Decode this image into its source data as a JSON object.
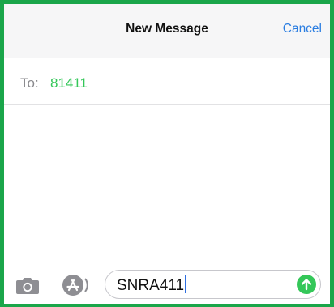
{
  "header": {
    "title": "New Message",
    "cancel_label": "Cancel"
  },
  "recipient": {
    "label": "To:",
    "value": "81411"
  },
  "composer": {
    "message_text": "SNRA411",
    "camera_icon": "camera-icon",
    "appstore_icon": "app-store-icon",
    "send_icon": "send-arrow-up-icon"
  },
  "colors": {
    "frame_border": "#1aa64a",
    "accent_blue": "#2a7de1",
    "recipient_green": "#34c759",
    "send_button": "#34c759"
  }
}
